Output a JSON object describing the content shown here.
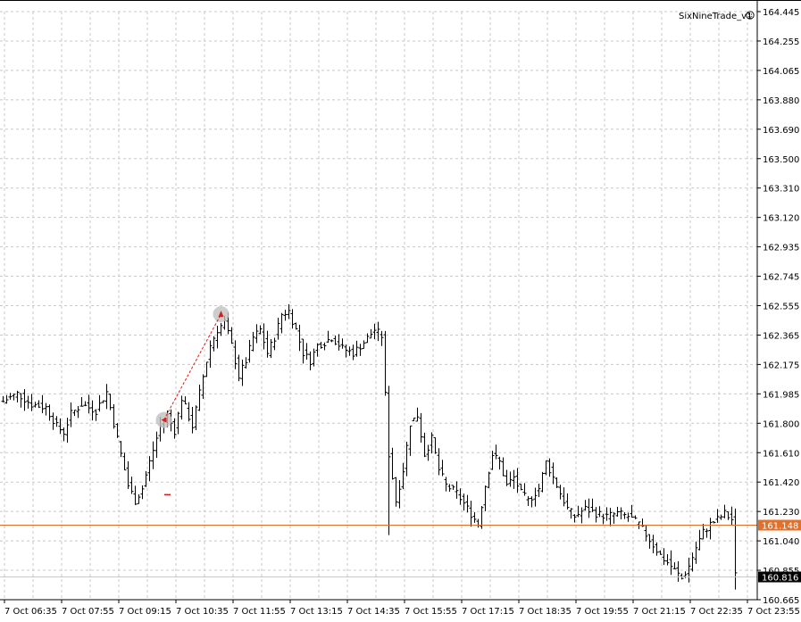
{
  "expert_advisor": {
    "name": "SixNineTrade_v1",
    "icon": "smiley-icon"
  },
  "colors": {
    "background": "#ffffff",
    "grid": "#c8c8c8",
    "bars": "#000000",
    "price_line": "#e0702a",
    "trade_line": "#d22020",
    "trade_marker": "#c0c0c0"
  },
  "chart_data": {
    "type": "ohlc",
    "y_axis": {
      "min": 160.665,
      "max": 164.445,
      "ticks": [
        "164.445",
        "164.255",
        "164.065",
        "163.880",
        "163.690",
        "163.500",
        "163.310",
        "163.120",
        "162.935",
        "162.745",
        "162.555",
        "162.365",
        "162.175",
        "161.985",
        "161.800",
        "161.610",
        "161.420",
        "161.230",
        "161.040",
        "160.855",
        "160.665"
      ]
    },
    "x_axis": {
      "ticks": [
        "7 Oct 06:35",
        "7 Oct 07:55",
        "7 Oct 09:15",
        "7 Oct 10:35",
        "7 Oct 11:55",
        "7 Oct 13:15",
        "7 Oct 14:35",
        "7 Oct 15:55",
        "7 Oct 17:15",
        "7 Oct 18:35",
        "7 Oct 19:55",
        "7 Oct 21:15",
        "7 Oct 22:35",
        "7 Oct 23:55"
      ]
    },
    "grid": true,
    "price_lines": [
      {
        "label": "161.148",
        "value": 161.148,
        "style": "orange"
      },
      {
        "label": "160.816",
        "value": 160.816,
        "style": "black"
      }
    ],
    "trade": {
      "entry": {
        "time_index": 45,
        "price": 161.82
      },
      "exit": {
        "time_index": 61,
        "price": 162.5
      },
      "pending_marker": {
        "time_index": 46,
        "price": 161.34
      }
    },
    "close_path": [
      [
        0,
        161.94
      ],
      [
        4,
        161.99
      ],
      [
        8,
        161.92
      ],
      [
        12,
        161.9
      ],
      [
        15,
        161.78
      ],
      [
        17,
        161.74
      ],
      [
        19,
        161.86
      ],
      [
        22,
        161.92
      ],
      [
        26,
        161.88
      ],
      [
        29,
        162.0
      ],
      [
        31,
        161.8
      ],
      [
        33,
        161.6
      ],
      [
        35,
        161.4
      ],
      [
        37,
        161.3
      ],
      [
        39,
        161.38
      ],
      [
        41,
        161.55
      ],
      [
        44,
        161.78
      ],
      [
        46,
        161.85
      ],
      [
        48,
        161.75
      ],
      [
        50,
        161.96
      ],
      [
        53,
        161.78
      ],
      [
        56,
        162.1
      ],
      [
        58,
        162.3
      ],
      [
        60,
        162.4
      ],
      [
        62,
        162.45
      ],
      [
        64,
        162.3
      ],
      [
        66,
        162.1
      ],
      [
        68,
        162.2
      ],
      [
        70,
        162.35
      ],
      [
        72,
        162.4
      ],
      [
        74,
        162.25
      ],
      [
        76,
        162.35
      ],
      [
        78,
        162.5
      ],
      [
        80,
        162.52
      ],
      [
        82,
        162.4
      ],
      [
        84,
        162.25
      ],
      [
        86,
        162.2
      ],
      [
        88,
        162.3
      ],
      [
        90,
        162.32
      ],
      [
        92,
        162.35
      ],
      [
        95,
        162.28
      ],
      [
        98,
        162.25
      ],
      [
        101,
        162.32
      ],
      [
        104,
        162.4
      ],
      [
        106,
        162.36
      ],
      [
        108,
        161.6
      ],
      [
        110,
        161.3
      ],
      [
        112,
        161.5
      ],
      [
        114,
        161.8
      ],
      [
        116,
        161.85
      ],
      [
        118,
        161.6
      ],
      [
        120,
        161.7
      ],
      [
        122,
        161.5
      ],
      [
        124,
        161.4
      ],
      [
        127,
        161.35
      ],
      [
        130,
        161.25
      ],
      [
        133,
        161.15
      ],
      [
        135,
        161.4
      ],
      [
        137,
        161.6
      ],
      [
        139,
        161.55
      ],
      [
        141,
        161.4
      ],
      [
        143,
        161.45
      ],
      [
        145,
        161.35
      ],
      [
        147,
        161.3
      ],
      [
        150,
        161.38
      ],
      [
        152,
        161.55
      ],
      [
        154,
        161.45
      ],
      [
        156,
        161.35
      ],
      [
        158,
        161.25
      ],
      [
        160,
        161.2
      ],
      [
        163,
        161.25
      ],
      [
        166,
        161.22
      ],
      [
        169,
        161.2
      ],
      [
        172,
        161.22
      ],
      [
        175,
        161.2
      ],
      [
        178,
        161.15
      ],
      [
        181,
        161.05
      ],
      [
        184,
        160.95
      ],
      [
        187,
        160.88
      ],
      [
        190,
        160.8
      ],
      [
        192,
        160.88
      ],
      [
        194,
        161.0
      ],
      [
        196,
        161.1
      ],
      [
        198,
        161.15
      ],
      [
        200,
        161.18
      ],
      [
        202,
        161.22
      ],
      [
        204,
        161.18
      ],
      [
        205,
        160.82
      ]
    ]
  }
}
